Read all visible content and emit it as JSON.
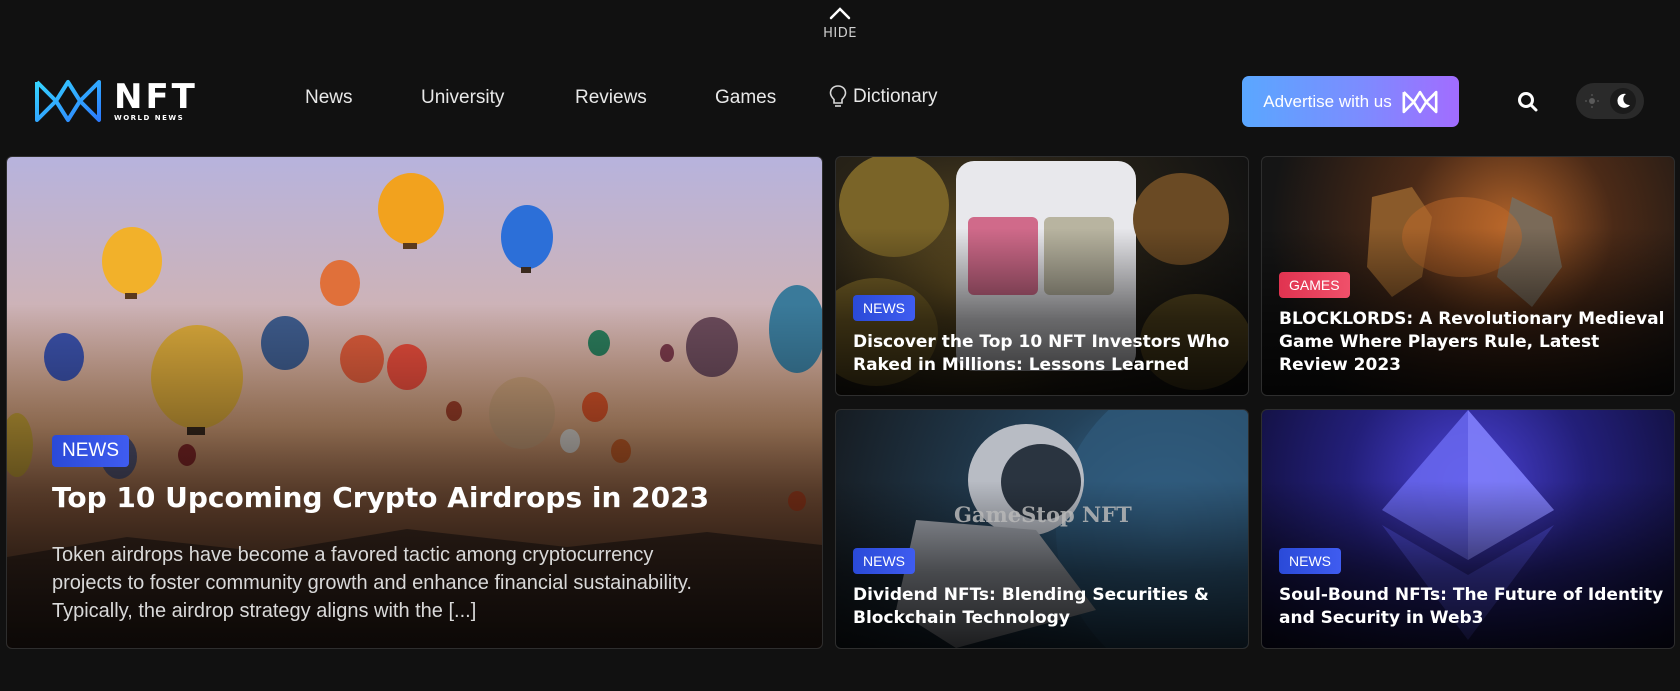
{
  "hide_toggle": {
    "label": "HIDE"
  },
  "logo": {
    "name": "NFT",
    "tagline": "WORLD NEWS"
  },
  "nav": {
    "items": [
      {
        "label": "News"
      },
      {
        "label": "University"
      },
      {
        "label": "Reviews"
      },
      {
        "label": "Games"
      },
      {
        "label": "Dictionary",
        "icon": "lightbulb-icon"
      }
    ],
    "advertise_label": "Advertise with us",
    "search_icon": "search-icon",
    "theme_toggle": {
      "state": "dark",
      "icons": [
        "sun-icon",
        "moon-icon"
      ]
    }
  },
  "featured": {
    "category": "NEWS",
    "title": "Top 10 Upcoming Crypto Airdrops in 2023",
    "excerpt_lines": [
      "Token airdrops have become a favored tactic among cryptocurrency",
      "projects to foster community growth and enhance financial sustainability.",
      "Typically, the airdrop strategy aligns with the [...]"
    ]
  },
  "articles": [
    {
      "category": "NEWS",
      "title_lines": [
        "Discover the Top 10 NFT Investors Who",
        "Raked in Millions: Lessons Learned"
      ]
    },
    {
      "category": "GAMES",
      "title_lines": [
        "BLOCKLORDS: A Revolutionary Medieval",
        "Game Where Players Rule, Latest",
        "Review 2023"
      ]
    },
    {
      "category": "NEWS",
      "title_lines": [
        "Dividend NFTs: Blending Securities &",
        "Blockchain Technology"
      ],
      "image_text": "GameStop NFT"
    },
    {
      "category": "NEWS",
      "title_lines": [
        "Soul-Bound NFTs: The Future of Identity",
        "and Security in Web3"
      ]
    }
  ],
  "colors": {
    "background": "#111111",
    "news_badge": "#3450e6",
    "games_badge": "#e8405c",
    "advertise_gradient": [
      "#5aa7ff",
      "#a26cff"
    ]
  }
}
